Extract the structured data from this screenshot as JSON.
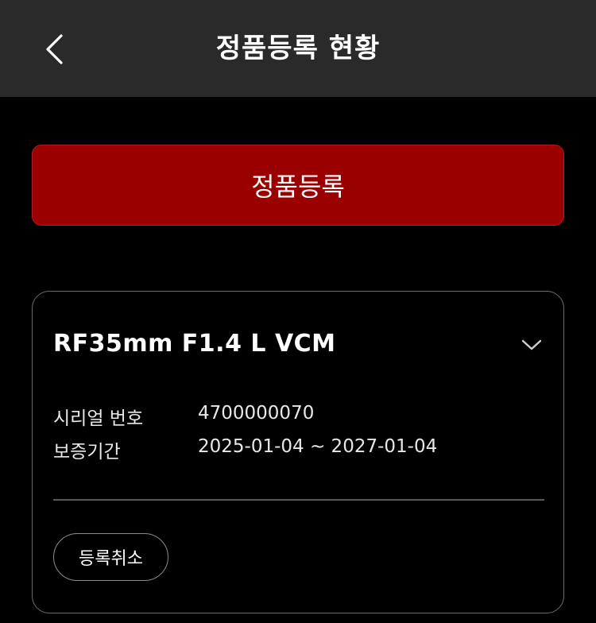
{
  "header": {
    "title": "정품등록 현황",
    "back_icon": "chevron-left-icon"
  },
  "register_button": {
    "label": "정품등록"
  },
  "product_card": {
    "product_name": "RF35mm F1.4 L VCM",
    "expand_icon": "chevron-down-icon",
    "serial": {
      "label": "시리얼 번호",
      "value": "4700000070"
    },
    "warranty": {
      "label": "보증기간",
      "value": "2025-01-04 ~ 2027-01-04"
    },
    "cancel_label": "등록취소"
  },
  "colors": {
    "background": "#000000",
    "header_bg": "#2a2a2a",
    "accent": "#9a0000",
    "text": "#ffffff",
    "card_border": "#6b6b6b"
  }
}
